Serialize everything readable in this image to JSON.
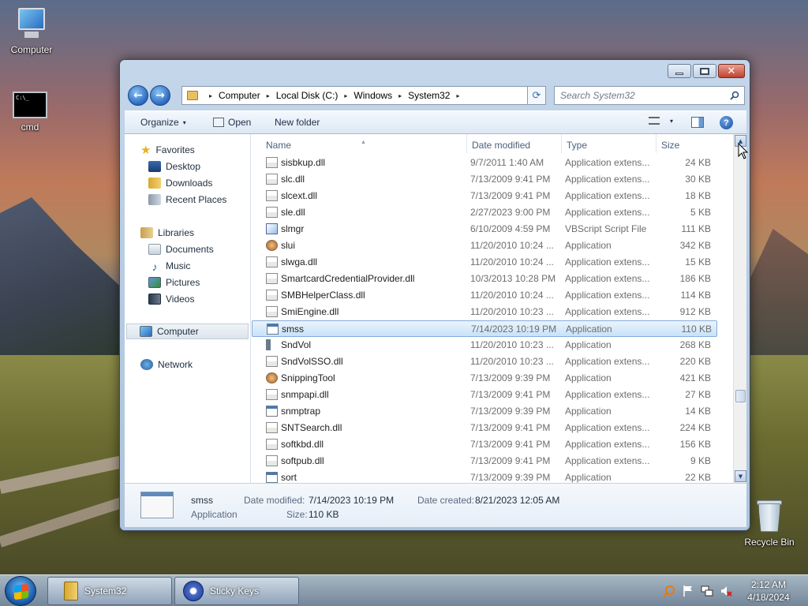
{
  "desktop": {
    "icons": {
      "computer": "Computer",
      "cmd": "cmd",
      "cmd_glyph": "C:\\_",
      "recycle": "Recycle Bin"
    }
  },
  "window": {
    "controls": {
      "minimize": "minimize",
      "maximize": "maximize",
      "close": "✕"
    },
    "nav": {
      "back": "←",
      "forward": "→"
    },
    "address": {
      "crumbs": [
        "Computer",
        "Local Disk (C:)",
        "Windows",
        "System32"
      ],
      "separator": "▸",
      "dropdown": "▾",
      "refresh": "⟳"
    },
    "search": {
      "placeholder": "Search System32"
    },
    "toolbar": {
      "organize": "Organize",
      "open": "Open",
      "new_folder": "New folder",
      "caret": "▾",
      "help": "?"
    },
    "nav_pane": {
      "favorites": "Favorites",
      "desktop": "Desktop",
      "downloads": "Downloads",
      "recent": "Recent Places",
      "libraries": "Libraries",
      "documents": "Documents",
      "music": "Music",
      "pictures": "Pictures",
      "videos": "Videos",
      "computer": "Computer",
      "network": "Network"
    },
    "columns": {
      "name": "Name",
      "date": "Date modified",
      "type": "Type",
      "size": "Size",
      "sort_glyph": "▲"
    },
    "files": [
      {
        "name": "sisbkup.dll",
        "date": "9/7/2011 1:40 AM",
        "type": "Application extens...",
        "size": "24 KB",
        "icon": "dll"
      },
      {
        "name": "slc.dll",
        "date": "7/13/2009 9:41 PM",
        "type": "Application extens...",
        "size": "30 KB",
        "icon": "dll"
      },
      {
        "name": "slcext.dll",
        "date": "7/13/2009 9:41 PM",
        "type": "Application extens...",
        "size": "18 KB",
        "icon": "dll"
      },
      {
        "name": "sle.dll",
        "date": "2/27/2023 9:00 PM",
        "type": "Application extens...",
        "size": "5 KB",
        "icon": "dll"
      },
      {
        "name": "slmgr",
        "date": "6/10/2009 4:59 PM",
        "type": "VBScript Script File",
        "size": "111 KB",
        "icon": "vbs"
      },
      {
        "name": "slui",
        "date": "11/20/2010 10:24 ...",
        "type": "Application",
        "size": "342 KB",
        "icon": "ui"
      },
      {
        "name": "slwga.dll",
        "date": "11/20/2010 10:24 ...",
        "type": "Application extens...",
        "size": "15 KB",
        "icon": "dll"
      },
      {
        "name": "SmartcardCredentialProvider.dll",
        "date": "10/3/2013 10:28 PM",
        "type": "Application extens...",
        "size": "186 KB",
        "icon": "dll"
      },
      {
        "name": "SMBHelperClass.dll",
        "date": "11/20/2010 10:24 ...",
        "type": "Application extens...",
        "size": "114 KB",
        "icon": "dll"
      },
      {
        "name": "SmiEngine.dll",
        "date": "11/20/2010 10:23 ...",
        "type": "Application extens...",
        "size": "912 KB",
        "icon": "dll"
      },
      {
        "name": "smss",
        "date": "7/14/2023 10:19 PM",
        "type": "Application",
        "size": "110 KB",
        "icon": "app",
        "selected": true
      },
      {
        "name": "SndVol",
        "date": "11/20/2010 10:23 ...",
        "type": "Application",
        "size": "268 KB",
        "icon": "snd"
      },
      {
        "name": "SndVolSSO.dll",
        "date": "11/20/2010 10:23 ...",
        "type": "Application extens...",
        "size": "220 KB",
        "icon": "dll"
      },
      {
        "name": "SnippingTool",
        "date": "7/13/2009 9:39 PM",
        "type": "Application",
        "size": "421 KB",
        "icon": "ui"
      },
      {
        "name": "snmpapi.dll",
        "date": "7/13/2009 9:41 PM",
        "type": "Application extens...",
        "size": "27 KB",
        "icon": "dll"
      },
      {
        "name": "snmptrap",
        "date": "7/13/2009 9:39 PM",
        "type": "Application",
        "size": "14 KB",
        "icon": "app"
      },
      {
        "name": "SNTSearch.dll",
        "date": "7/13/2009 9:41 PM",
        "type": "Application extens...",
        "size": "224 KB",
        "icon": "dll"
      },
      {
        "name": "softkbd.dll",
        "date": "7/13/2009 9:41 PM",
        "type": "Application extens...",
        "size": "156 KB",
        "icon": "dll"
      },
      {
        "name": "softpub.dll",
        "date": "7/13/2009 9:41 PM",
        "type": "Application extens...",
        "size": "9 KB",
        "icon": "dll"
      },
      {
        "name": "sort",
        "date": "7/13/2009 9:39 PM",
        "type": "Application",
        "size": "22 KB",
        "icon": "app"
      }
    ],
    "scrollbar": {
      "up": "▲",
      "down": "▼"
    },
    "details": {
      "name": "smss",
      "type": "Application",
      "modified_label": "Date modified:",
      "modified_value": "7/14/2023 10:19 PM",
      "created_label": "Date created:",
      "created_value": "8/21/2023 12:05 AM",
      "size_label": "Size:",
      "size_value": "110 KB"
    }
  },
  "taskbar": {
    "buttons": {
      "explorer": "System32",
      "sticky": "Sticky Keys"
    },
    "clock": {
      "time": "2:12 AM",
      "date": "4/18/2024"
    }
  }
}
